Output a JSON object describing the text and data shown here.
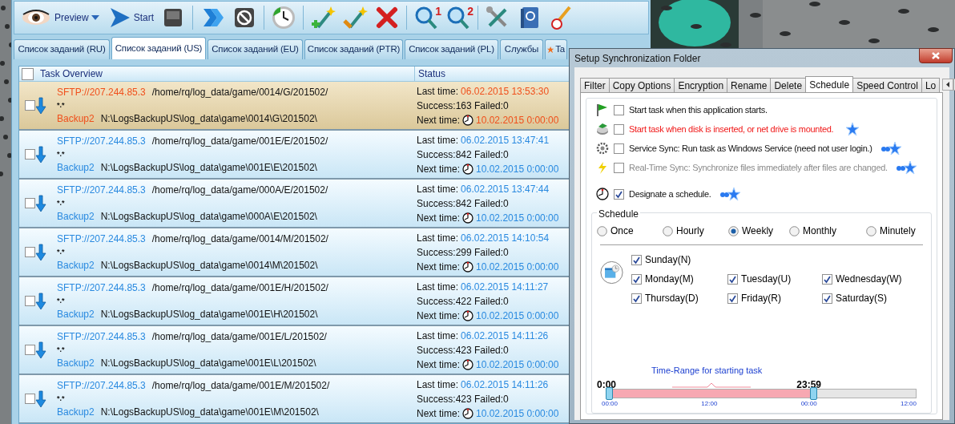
{
  "toolbar": [
    {
      "kind": "eye",
      "label": "Preview",
      "dropdown": true
    },
    {
      "kind": "play",
      "label": "Start"
    },
    {
      "kind": "stop"
    },
    {
      "kind": "chevrons"
    },
    {
      "kind": "ban"
    },
    {
      "kind": "clock"
    },
    {
      "kind": "wand-plus"
    },
    {
      "kind": "wand-wrench"
    },
    {
      "kind": "delete"
    },
    {
      "kind": "magnifier",
      "badge": "1"
    },
    {
      "kind": "magnifier",
      "badge": "2"
    },
    {
      "kind": "tools"
    },
    {
      "kind": "help"
    },
    {
      "kind": "brush"
    }
  ],
  "tabs": [
    {
      "label": "Список заданий (RU)",
      "selected": false
    },
    {
      "label": "Список заданий (US)",
      "selected": true
    },
    {
      "label": "Список заданий (EU)",
      "selected": false
    },
    {
      "label": "Список заданий (PTR)",
      "selected": false
    },
    {
      "label": "Список заданий (PL)",
      "selected": false
    },
    {
      "label": "Службы",
      "selected": false
    },
    {
      "label": "Ta",
      "selected": false,
      "kind": "star"
    }
  ],
  "table": {
    "columns": [
      "Task Overview",
      "Status"
    ],
    "header_checked": false,
    "rows": [
      {
        "selected": true,
        "checked": false,
        "source": "SFTP://207.244.85.3",
        "source_path": "/home/rq/log_data/game/0014/G/201502/",
        "mask": "*.*",
        "target": "Backup2",
        "target_path": "N:\\LogsBackupUS\\log_data\\game\\0014\\G\\201502\\",
        "last_label": "Last time:",
        "last_time": "06.02.2015 13:53:30",
        "counts": "Success:163 Failed:0",
        "next_label": "Next time:",
        "next_time": "10.02.2015 0:00:00"
      },
      {
        "selected": false,
        "checked": false,
        "source": "SFTP://207.244.85.3",
        "source_path": "/home/rq/log_data/game/001E/E/201502/",
        "mask": "*.*",
        "target": "Backup2",
        "target_path": "N:\\LogsBackupUS\\log_data\\game\\001E\\E\\201502\\",
        "last_label": "Last time:",
        "last_time": "06.02.2015 13:47:41",
        "counts": "Success:842 Failed:0",
        "next_label": "Next time:",
        "next_time": "10.02.2015 0:00:00"
      },
      {
        "selected": false,
        "checked": false,
        "source": "SFTP://207.244.85.3",
        "source_path": "/home/rq/log_data/game/000A/E/201502/",
        "mask": "*.*",
        "target": "Backup2",
        "target_path": "N:\\LogsBackupUS\\log_data\\game\\000A\\E\\201502\\",
        "last_label": "Last time:",
        "last_time": "06.02.2015 13:47:44",
        "counts": "Success:842 Failed:0",
        "next_label": "Next time:",
        "next_time": "10.02.2015 0:00:00"
      },
      {
        "selected": false,
        "checked": false,
        "source": "SFTP://207.244.85.3",
        "source_path": "/home/rq/log_data/game/0014/M/201502/",
        "mask": "*.*",
        "target": "Backup2",
        "target_path": "N:\\LogsBackupUS\\log_data\\game\\0014\\M\\201502\\",
        "last_label": "Last time:",
        "last_time": "06.02.2015 14:10:54",
        "counts": "Success:299 Failed:0",
        "next_label": "Next time:",
        "next_time": "10.02.2015 0:00:00"
      },
      {
        "selected": false,
        "checked": false,
        "source": "SFTP://207.244.85.3",
        "source_path": "/home/rq/log_data/game/001E/H/201502/",
        "mask": "*.*",
        "target": "Backup2",
        "target_path": "N:\\LogsBackupUS\\log_data\\game\\001E\\H\\201502\\",
        "last_label": "Last time:",
        "last_time": "06.02.2015 14:11:27",
        "counts": "Success:422 Failed:0",
        "next_label": "Next time:",
        "next_time": "10.02.2015 0:00:00"
      },
      {
        "selected": false,
        "checked": false,
        "source": "SFTP://207.244.85.3",
        "source_path": "/home/rq/log_data/game/001E/L/201502/",
        "mask": "*.*",
        "target": "Backup2",
        "target_path": "N:\\LogsBackupUS\\log_data\\game\\001E\\L\\201502\\",
        "last_label": "Last time:",
        "last_time": "06.02.2015 14:11:26",
        "counts": "Success:423 Failed:0",
        "next_label": "Next time:",
        "next_time": "10.02.2015 0:00:00"
      },
      {
        "selected": false,
        "checked": false,
        "source": "SFTP://207.244.85.3",
        "source_path": "/home/rq/log_data/game/001E/M/201502/",
        "mask": "*.*",
        "target": "Backup2",
        "target_path": "N:\\LogsBackupUS\\log_data\\game\\001E\\M\\201502\\",
        "last_label": "Last time:",
        "last_time": "06.02.2015 14:11:26",
        "counts": "Success:423 Failed:0",
        "next_label": "Next time:",
        "next_time": "10.02.2015 0:00:00"
      }
    ]
  },
  "dialog": {
    "title": "Setup Synchronization Folder",
    "tabs": [
      {
        "label": "Filter",
        "selected": false
      },
      {
        "label": "Copy Options",
        "selected": false
      },
      {
        "label": "Encryption",
        "selected": false
      },
      {
        "label": "Rename",
        "selected": false
      },
      {
        "label": "Delete",
        "selected": false
      },
      {
        "label": "Schedule",
        "selected": true
      },
      {
        "label": "Speed Control",
        "selected": false
      },
      {
        "label": "Lo",
        "selected": false
      }
    ],
    "options": [
      {
        "kind": "flag",
        "label": "Start task when this application starts.",
        "checked": false,
        "disabled": false
      },
      {
        "kind": "disk",
        "label": "Start task when disk is inserted, or net drive is mounted.",
        "checked": false,
        "disabled": false
      },
      {
        "kind": "gear",
        "label": "Service Sync: Run task as Windows Service (need not user login.)",
        "checked": false,
        "disabled": false
      },
      {
        "kind": "bolt",
        "label": "Real-Time Sync: Synchronize files immediately after files are changed.",
        "checked": false,
        "disabled": true
      },
      {
        "kind": "clock",
        "label": "Designate a schedule.",
        "checked": true,
        "disabled": false
      }
    ],
    "schedule": {
      "title": "Schedule",
      "modes": [
        {
          "label": "Once",
          "selected": false
        },
        {
          "label": "Hourly",
          "selected": false
        },
        {
          "label": "Weekly",
          "selected": true
        },
        {
          "label": "Monthly",
          "selected": false
        },
        {
          "label": "Minutely",
          "selected": false
        }
      ],
      "days": [
        {
          "label": "Sunday(N)",
          "checked": true
        },
        {
          "label": "Monday(M)",
          "checked": true
        },
        {
          "label": "Tuesday(U)",
          "checked": true
        },
        {
          "label": "Wednesday(W)",
          "checked": true
        },
        {
          "label": "Thursday(D)",
          "checked": true
        },
        {
          "label": "Friday(R)",
          "checked": true
        },
        {
          "label": "Saturday(S)",
          "checked": true
        }
      ],
      "range": {
        "caption": "Time-Range for starting task",
        "start": "0:00",
        "end": "23:59",
        "level": 0.665,
        "ticks": [
          "00:00",
          "12:00",
          "00:00",
          "12:00"
        ]
      }
    }
  }
}
